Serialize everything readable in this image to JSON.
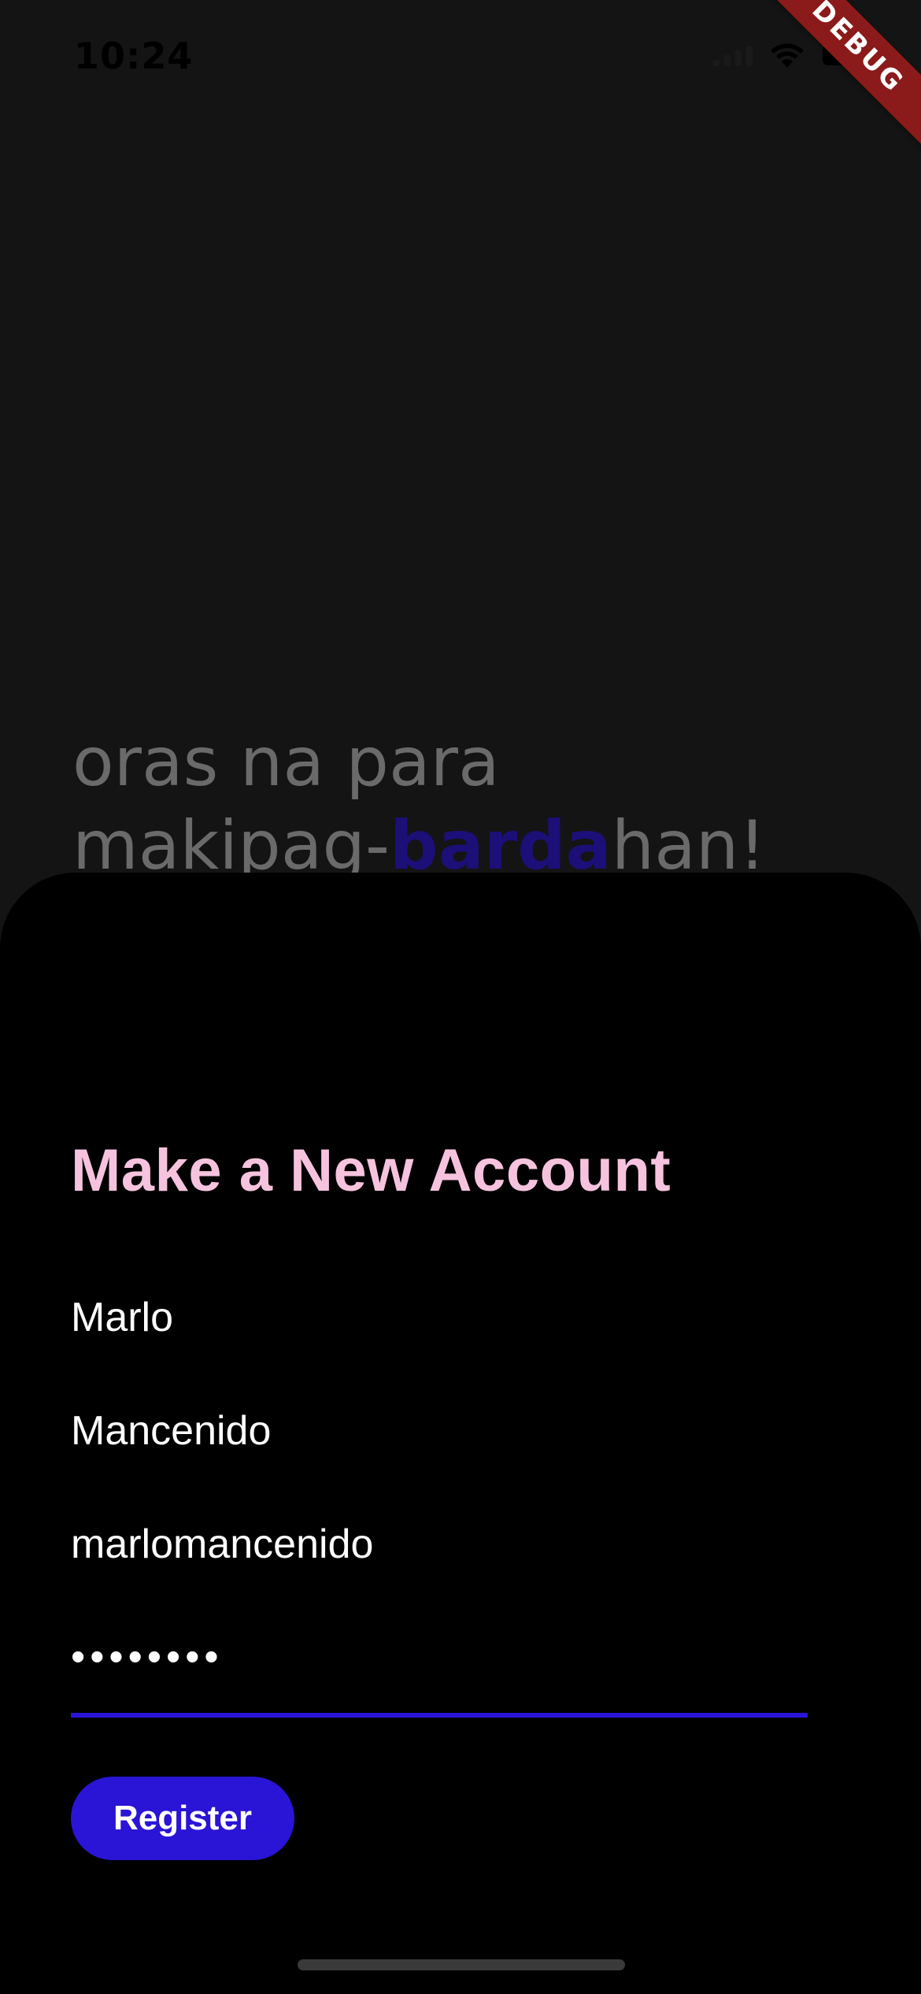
{
  "status_bar": {
    "time": "10:24"
  },
  "debug_banner": {
    "label": "DEBUG"
  },
  "tagline": {
    "line1": "oras na para",
    "line2_prefix": "makipag-",
    "line2_highlight": "barda",
    "line2_suffix": "han!"
  },
  "register": {
    "title": "Make a New Account",
    "first_name_value": "Marlo",
    "last_name_value": "Mancenido",
    "username_value": "marlomancenido",
    "password_value": "••••••••",
    "button_label": "Register"
  },
  "colors": {
    "accent": "#2a14d6",
    "title_pink": "#f6c3de",
    "highlight_text": "#1c0f78",
    "sheet_bg": "#000000",
    "page_bg": "#141414"
  },
  "icons": [
    "cellular-signal-icon",
    "wifi-icon",
    "battery-icon"
  ]
}
